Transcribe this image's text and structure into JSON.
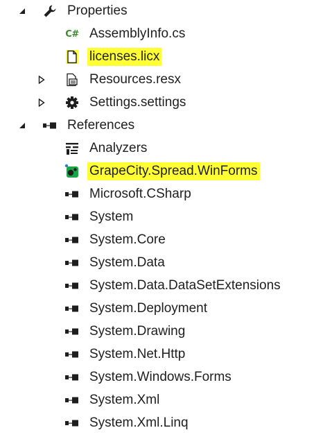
{
  "tree": {
    "properties": {
      "label": "Properties",
      "children": {
        "assembly_info": {
          "label": "AssemblyInfo.cs",
          "icon_text": "C#"
        },
        "licenses": {
          "label": "licenses.licx"
        },
        "resources": {
          "label": "Resources.resx"
        },
        "settings": {
          "label": "Settings.settings"
        }
      }
    },
    "references": {
      "label": "References",
      "children": [
        {
          "label": "Analyzers"
        },
        {
          "label": "GrapeCity.Spread.WinForms"
        },
        {
          "label": "Microsoft.CSharp"
        },
        {
          "label": "System"
        },
        {
          "label": "System.Core"
        },
        {
          "label": "System.Data"
        },
        {
          "label": "System.Data.DataSetExtensions"
        },
        {
          "label": "System.Deployment"
        },
        {
          "label": "System.Drawing"
        },
        {
          "label": "System.Net.Http"
        },
        {
          "label": "System.Windows.Forms"
        },
        {
          "label": "System.Xml"
        },
        {
          "label": "System.Xml.Linq"
        }
      ]
    }
  },
  "colors": {
    "highlight": "#ffff33",
    "text": "#1e1e1e",
    "csharp_icon": "#3a8a2a",
    "nuget_icon": "#1aa648"
  },
  "icons": {
    "properties": "wrench-icon",
    "assembly_info": "csharp-file-icon",
    "licenses": "file-icon",
    "resources": "resource-file-icon",
    "settings": "gear-icon",
    "references": "references-icon",
    "analyzers": "analyzers-icon",
    "grapecity": "package-icon",
    "assembly_reference": "assembly-reference-icon"
  }
}
